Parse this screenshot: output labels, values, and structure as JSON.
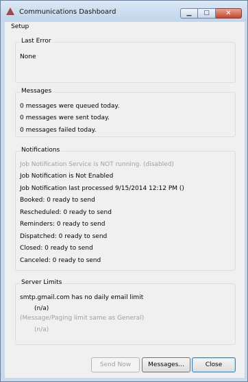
{
  "window": {
    "title": "Communications Dashboard",
    "minimize_glyph": "▁",
    "maximize_glyph": "□",
    "close_glyph": "✕"
  },
  "menu": {
    "setup_label": "Setup"
  },
  "last_error": {
    "title": "Last Error",
    "value": "None"
  },
  "messages": {
    "title": "Messages",
    "lines": [
      "0 messages were queued today.",
      "0 messages were sent today.",
      "0 messages failed today."
    ]
  },
  "notifications": {
    "title": "Notifications",
    "service_status": "Job Notification Service is NOT running. (disabled)",
    "lines": [
      "Job Notification is Not Enabled",
      "Job Notification last processed 9/15/2014 12:12 PM ()",
      "Booked: 0 ready to send",
      "Rescheduled: 0 ready to send",
      "Reminders: 0 ready to send",
      "Dispatched: 0 ready to send",
      "Closed: 0 ready to send",
      "Canceled: 0 ready to send"
    ]
  },
  "server_limits": {
    "title": "Server Limits",
    "email_limit": "smtp.gmail.com has no daily email limit",
    "email_value": "(n/a)",
    "paging_limit": "(Message/Paging limit same as General)",
    "paging_value": "(n/a)"
  },
  "buttons": {
    "send_now": "Send Now",
    "messages": "Messages...",
    "close": "Close"
  }
}
